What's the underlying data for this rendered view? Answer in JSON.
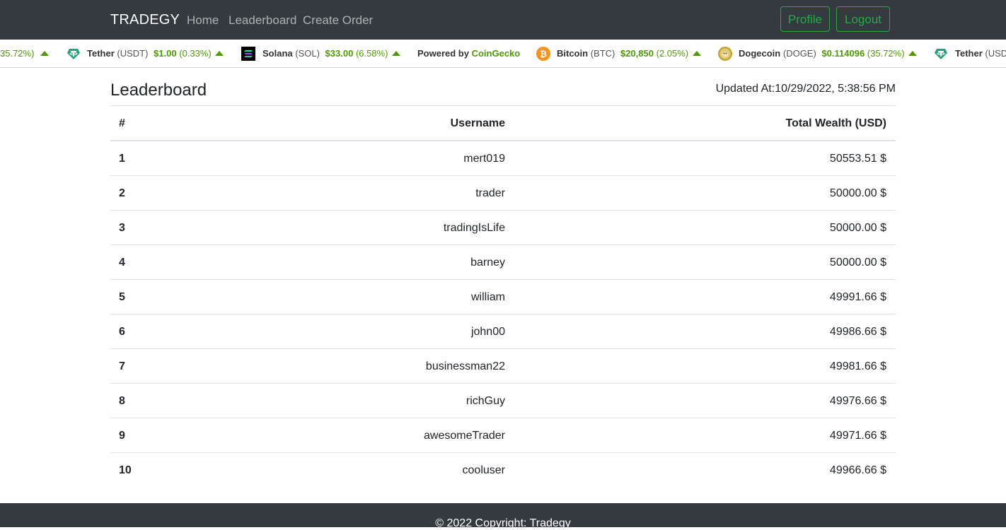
{
  "navbar": {
    "brand": "TRADEGY",
    "links": [
      "Home",
      "Leaderboard",
      "Create Order"
    ],
    "buttons": [
      "Profile",
      "Logout"
    ]
  },
  "ticker": {
    "items": [
      {
        "name": "",
        "symbol": "",
        "price": "",
        "change": "35.72%)",
        "icon": "none"
      },
      {
        "name": "Tether",
        "symbol": "(USDT)",
        "price": "$1.00",
        "change": "(0.33%)",
        "icon": "tether-icon"
      },
      {
        "name": "Solana",
        "symbol": "(SOL)",
        "price": "$33.00",
        "change": "(6.58%)",
        "icon": "solana-icon"
      },
      {
        "name": "Bitcoin",
        "symbol": "(BTC)",
        "price": "$20,850",
        "change": "(2.05%)",
        "icon": "bitcoin-icon"
      },
      {
        "name": "Dogecoin",
        "symbol": "(DOGE)",
        "price": "$0.114096",
        "change": "(35.72%)",
        "icon": "dogecoin-icon"
      },
      {
        "name": "Tether",
        "symbol": "(USD",
        "price": "",
        "change": "",
        "icon": "tether-icon"
      }
    ],
    "powered_by": "Powered by",
    "powered_by_brand": "CoinGecko",
    "colors": {
      "up": "#4e9a06",
      "bitcoin": "#f7931a",
      "tether": "#26a17b"
    }
  },
  "main": {
    "title": "Leaderboard",
    "updated": "Updated At:10/29/2022, 5:38:56 PM",
    "table": {
      "headers": [
        "#",
        "Username",
        "Total Wealth (USD)"
      ],
      "rows": [
        [
          "1",
          "mert019",
          "50553.51 $"
        ],
        [
          "2",
          "trader",
          "50000.00 $"
        ],
        [
          "3",
          "tradingIsLife",
          "50000.00 $"
        ],
        [
          "4",
          "barney",
          "50000.00 $"
        ],
        [
          "5",
          "william",
          "49991.66 $"
        ],
        [
          "6",
          "john00",
          "49986.66 $"
        ],
        [
          "7",
          "businessman22",
          "49981.66 $"
        ],
        [
          "8",
          "richGuy",
          "49976.66 $"
        ],
        [
          "9",
          "awesomeTrader",
          "49971.66 $"
        ],
        [
          "10",
          "cooluser",
          "49966.66 $"
        ]
      ]
    }
  },
  "footer": {
    "text": "© 2022 Copyright: Tradegy"
  }
}
